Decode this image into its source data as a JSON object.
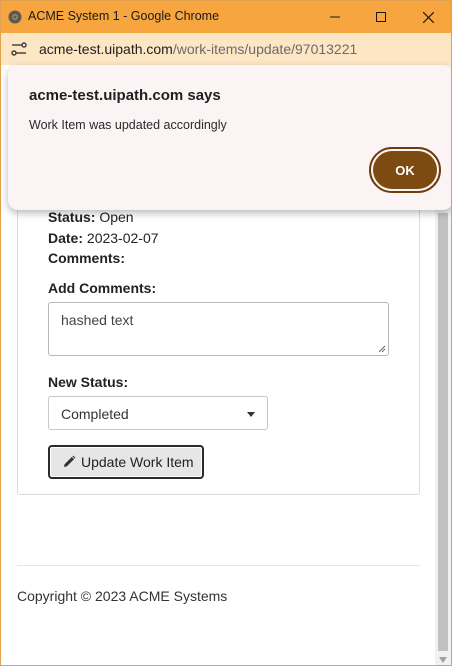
{
  "window": {
    "title": "ACME System 1 - Google Chrome",
    "controls": [
      "minimize-icon",
      "maximize-icon",
      "close-icon"
    ]
  },
  "addressbar": {
    "url_host": "acme-test.uipath.com",
    "url_path": "/work-items/update/97013221"
  },
  "work_item": {
    "status_label": "Status:",
    "status_value": "Open",
    "date_label": "Date:",
    "date_value": "2023-02-07",
    "comments_label": "Comments:"
  },
  "form": {
    "add_comments_label": "Add Comments:",
    "comments_value": "hashed text",
    "new_status_label": "New Status:",
    "new_status_value": "Completed",
    "update_button_label": "Update Work Item"
  },
  "footer": {
    "copyright": "Copyright © 2023 ACME Systems"
  },
  "dialog": {
    "title": "acme-test.uipath.com says",
    "message": "Work Item was updated accordingly",
    "ok_label": "OK"
  },
  "colors": {
    "titlebar": "#f7a63f",
    "addressbar": "#fde6c4",
    "ok_button": "#7d4a12",
    "dialog_bg": "#fcf3f5"
  }
}
